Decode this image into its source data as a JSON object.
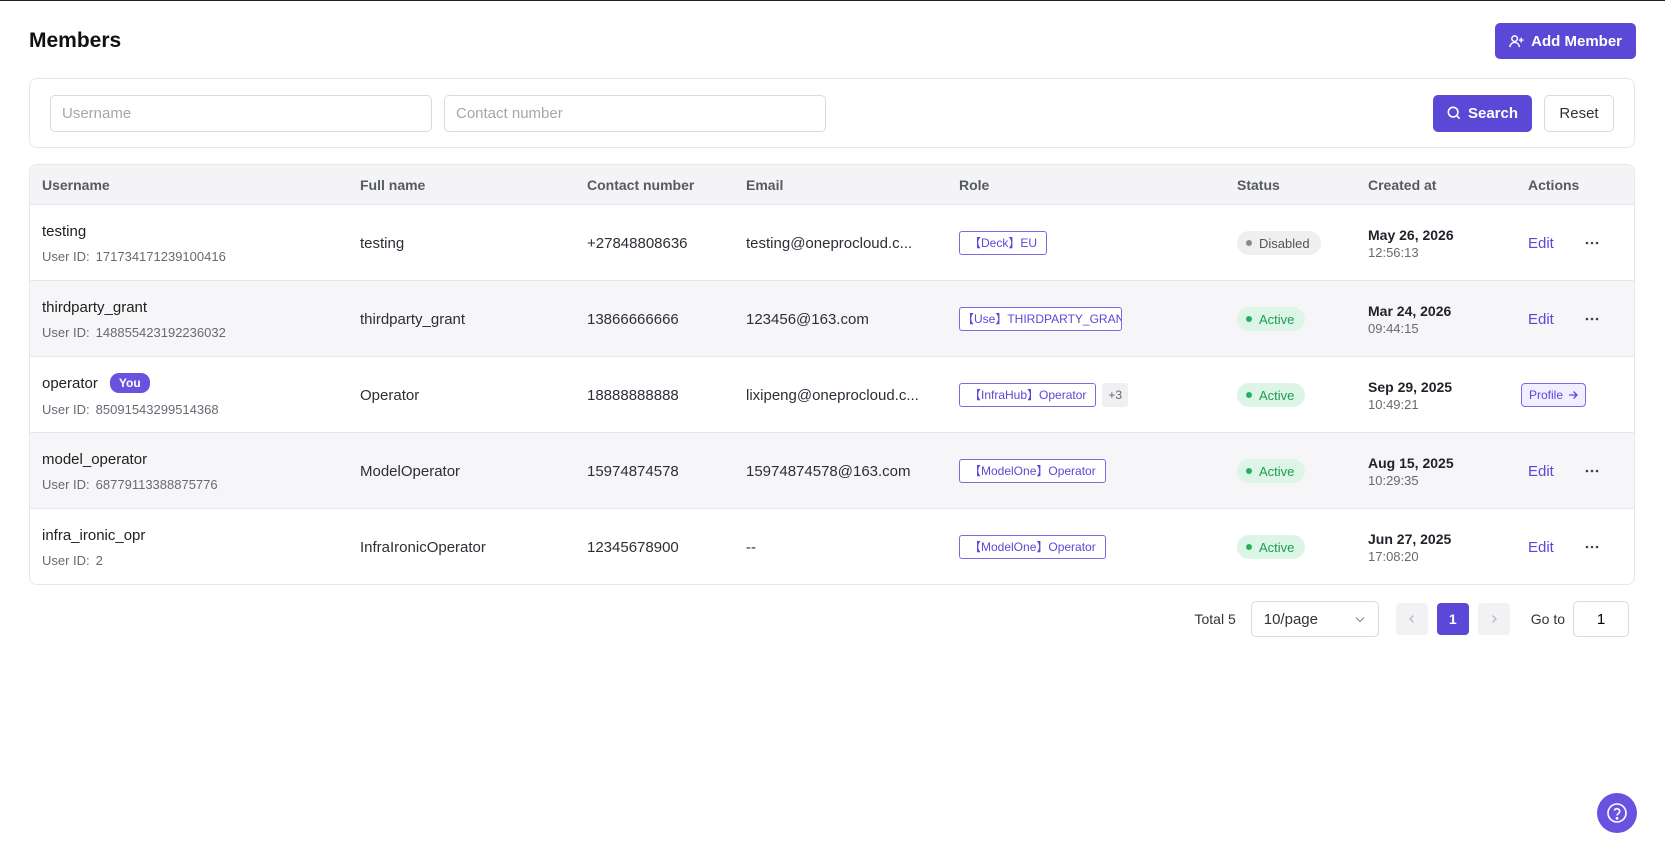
{
  "page": {
    "title": "Members",
    "add_button_label": "Add Member"
  },
  "filters": {
    "username_placeholder": "Username",
    "contact_placeholder": "Contact number",
    "search_label": "Search",
    "reset_label": "Reset"
  },
  "table": {
    "columns": [
      "Username",
      "Full name",
      "Contact number",
      "Email",
      "Role",
      "Status",
      "Created at",
      "Actions"
    ],
    "user_id_label": "User ID:",
    "you_badge": "You",
    "edit_label": "Edit",
    "profile_label": "Profile",
    "rows": [
      {
        "username": "testing",
        "user_id": "171734171239100416",
        "full_name": "testing",
        "contact": "+27848808636",
        "email": "testing@oneprocloud.c...",
        "roles": [
          "【Deck】EU"
        ],
        "more_roles": "",
        "status": "Disabled",
        "date": "May 26, 2026",
        "time": "12:56:13"
      },
      {
        "username": "thirdparty_grant",
        "user_id": "148855423192236032",
        "full_name": "thirdparty_grant",
        "contact": "13866666666",
        "email": "123456@163.com",
        "roles": [
          "【Use】THIRDPARTY_GRANT"
        ],
        "more_roles": "",
        "status": "Active",
        "date": "Mar 24, 2026",
        "time": "09:44:15"
      },
      {
        "username": "operator",
        "user_id": "85091543299514368",
        "full_name": "Operator",
        "contact": "18888888888",
        "email": "lixipeng@oneprocloud.c...",
        "roles": [
          "【InfraHub】Operator"
        ],
        "more_roles": "+3",
        "status": "Active",
        "date": "Sep 29, 2025",
        "time": "10:49:21"
      },
      {
        "username": "model_operator",
        "user_id": "68779113388875776",
        "full_name": "ModelOperator",
        "contact": "15974874578",
        "email": "15974874578@163.com",
        "roles": [
          "【ModelOne】Operator"
        ],
        "more_roles": "",
        "status": "Active",
        "date": "Aug 15, 2025",
        "time": "10:29:35"
      },
      {
        "username": "infra_ironic_opr",
        "user_id": "2",
        "full_name": "InfraIronicOperator",
        "contact": "12345678900",
        "email": "--",
        "roles": [
          "【ModelOne】Operator"
        ],
        "more_roles": "",
        "status": "Active",
        "date": "Jun 27, 2025",
        "time": "17:08:20"
      }
    ]
  },
  "pagination": {
    "total": "Total 5",
    "page_size": "10/page",
    "current_page": "1",
    "goto_label": "Go to",
    "goto_value": "1"
  },
  "colors": {
    "accent": "#5b48d6",
    "active": "#22b35e"
  },
  "icons": [
    "add-user-icon",
    "search-icon",
    "more-icon",
    "arrow-right-icon",
    "chevron-down-icon",
    "chevron-left-icon",
    "chevron-right-icon",
    "help-icon"
  ]
}
